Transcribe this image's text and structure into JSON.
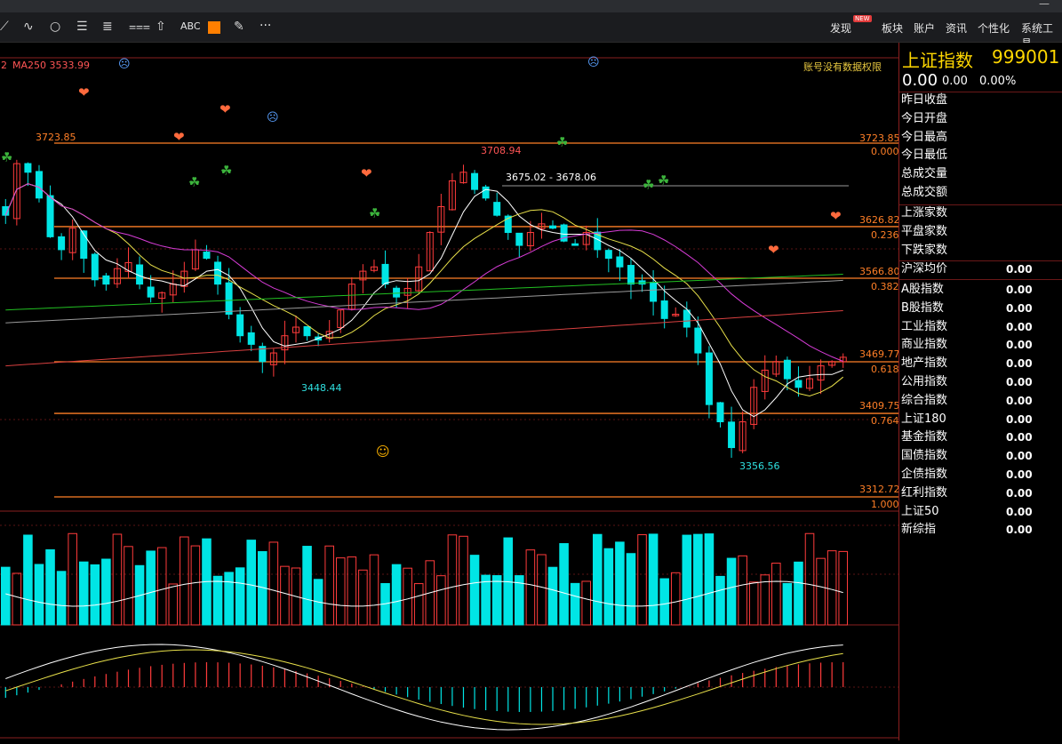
{
  "window": {
    "minimize": "—"
  },
  "toolbar": {
    "abc_label": "ABC",
    "more_label": "···",
    "accent_color": "#ff7f00",
    "menu": [
      {
        "label": "发现",
        "badge": "NEW"
      },
      {
        "label": "板块"
      },
      {
        "label": "账户"
      },
      {
        "label": "资讯"
      },
      {
        "label": "个性化"
      },
      {
        "label": "系统工具"
      }
    ]
  },
  "chart": {
    "ma_prefix": "2",
    "ma_label": "MA250 3533.99",
    "notice": "账号没有数据权限",
    "high_label": "3723.85",
    "peak_label": "3708.94",
    "low_label": "3356.56",
    "mid_low_label": "3448.44",
    "range_label": "3675.02 - 3678.06",
    "fib_levels": [
      {
        "price": "3723.85",
        "ratio": "0.000"
      },
      {
        "price": "3626.82",
        "ratio": "0.236"
      },
      {
        "price": "3566.80",
        "ratio": "0.382"
      },
      {
        "price": "3469.77",
        "ratio": "0.618"
      },
      {
        "price": "3409.75",
        "ratio": "0.764"
      },
      {
        "price": "3312.72",
        "ratio": "1.000"
      }
    ],
    "colors": {
      "up": "#ff3b3b",
      "down": "#00e5e5",
      "fib": "#ff7f27",
      "ma5": "#ffffff",
      "ma10": "#e8e04a",
      "ma20": "#d63cd6",
      "ma60": "#22c022",
      "ma120": "#9a9a9a",
      "ma250": "#d84040"
    }
  },
  "side": {
    "name": "上证指数",
    "code": "999001",
    "price": "0.00",
    "change": "0.00",
    "pct": "0.00%",
    "quote_rows": [
      "昨日收盘",
      "今日开盘",
      "今日最高",
      "今日最低",
      "总成交量",
      "总成交额"
    ],
    "breadth_rows": [
      "上涨家数",
      "平盘家数",
      "下跌家数"
    ],
    "avg_row": {
      "label": "沪深均价",
      "value": "0.00"
    },
    "index_rows": [
      {
        "label": "A股指数",
        "value": "0.00"
      },
      {
        "label": "B股指数",
        "value": "0.00"
      },
      {
        "label": "工业指数",
        "value": "0.00"
      },
      {
        "label": "商业指数",
        "value": "0.00"
      },
      {
        "label": "地产指数",
        "value": "0.00"
      },
      {
        "label": "公用指数",
        "value": "0.00"
      },
      {
        "label": "综合指数",
        "value": "0.00"
      },
      {
        "label": "上证180",
        "value": "0.00"
      },
      {
        "label": "基金指数",
        "value": "0.00"
      },
      {
        "label": "国债指数",
        "value": "0.00"
      },
      {
        "label": "企债指数",
        "value": "0.00"
      },
      {
        "label": "红利指数",
        "value": "0.00"
      },
      {
        "label": "上证50",
        "value": "0.00"
      },
      {
        "label": "新综指",
        "value": "0.00"
      }
    ]
  }
}
